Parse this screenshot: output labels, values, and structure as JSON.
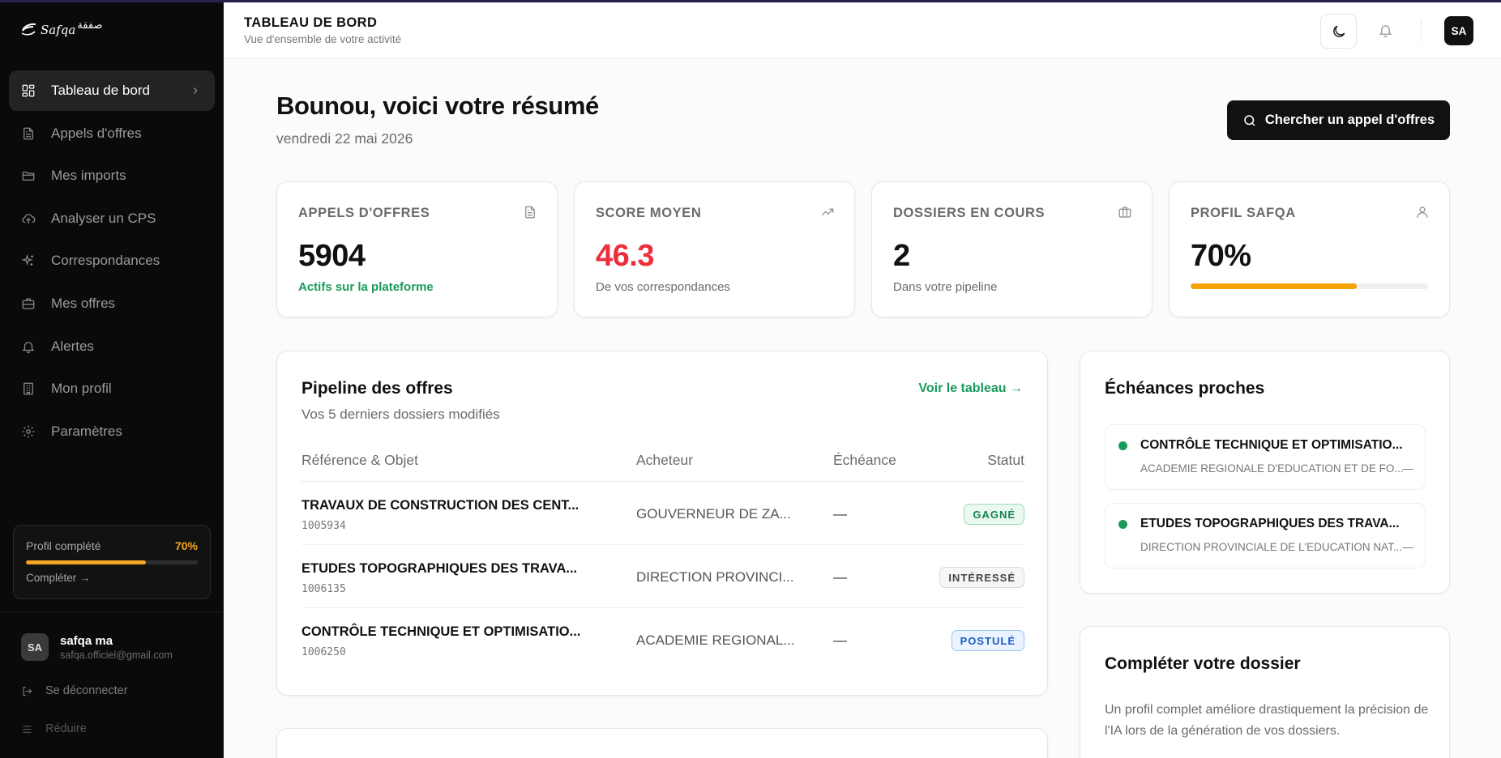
{
  "sidebar": {
    "logo": {
      "latin": "Safqa",
      "arabic": "صفقة"
    },
    "nav": [
      {
        "label": "Tableau de bord",
        "icon": "grid-icon"
      },
      {
        "label": "Appels d'offres",
        "icon": "document-icon"
      },
      {
        "label": "Mes imports",
        "icon": "folder-icon"
      },
      {
        "label": "Analyser un CPS",
        "icon": "upload-cloud-icon"
      },
      {
        "label": "Correspondances",
        "icon": "sparkles-icon"
      },
      {
        "label": "Mes offres",
        "icon": "briefcase-icon"
      },
      {
        "label": "Alertes",
        "icon": "bell-icon"
      },
      {
        "label": "Mon profil",
        "icon": "building-icon"
      },
      {
        "label": "Paramètres",
        "icon": "gear-icon"
      }
    ],
    "profile_progress": {
      "label": "Profil complété",
      "percent_label": "70%",
      "value": 0.7,
      "link": "Compléter →"
    },
    "user": {
      "initials": "SA",
      "name": "safqa ma",
      "email": "safqa.officiel@gmail.com"
    },
    "logout_label": "Se déconnecter",
    "collapse_label": "Réduire"
  },
  "header": {
    "title": "TABLEAU DE BORD",
    "subtitle": "Vue d'ensemble de votre activité",
    "avatar_initials": "SA"
  },
  "main": {
    "greeting": "Bounou, voici votre résumé",
    "date": "vendredi 22 mai 2026",
    "search_button": "Chercher un appel d'offres",
    "stats": [
      {
        "label": "APPELS D'OFFRES",
        "value": "5904",
        "sub": "Actifs sur la plateforme",
        "icon": "document-icon"
      },
      {
        "label": "SCORE MOYEN",
        "value": "46.3",
        "sub": "De vos correspondances",
        "icon": "trending-up-icon"
      },
      {
        "label": "DOSSIERS EN COURS",
        "value": "2",
        "sub": "Dans votre pipeline",
        "icon": "briefcase-icon"
      },
      {
        "label": "PROFIL SAFQA",
        "value": "70%",
        "progress": 0.7,
        "icon": "user-icon"
      }
    ],
    "pipeline": {
      "title": "Pipeline des offres",
      "subtitle": "Vos 5 derniers dossiers modifiés",
      "link": "Voir le tableau →",
      "columns": [
        "Référence & Objet",
        "Acheteur",
        "Échéance",
        "Statut"
      ],
      "rows": [
        {
          "title": "TRAVAUX DE CONSTRUCTION DES CENT...",
          "ref": "1005934",
          "buyer": "GOUVERNEUR DE ZA...",
          "deadline": "—",
          "status": "GAGNÉ"
        },
        {
          "title": "ETUDES TOPOGRAPHIQUES DES TRAVA...",
          "ref": "1006135",
          "buyer": "DIRECTION PROVINCI...",
          "deadline": "—",
          "status": "INTÉRESSÉ"
        },
        {
          "title": "CONTRÔLE TECHNIQUE ET OPTIMISATIO...",
          "ref": "1006250",
          "buyer": "ACADEMIE REGIONAL...",
          "deadline": "—",
          "status": "POSTULÉ"
        }
      ]
    },
    "echeances": {
      "title": "Échéances proches",
      "items": [
        {
          "title": "CONTRÔLE TECHNIQUE ET OPTIMISATIO...",
          "sub": "ACADEMIE REGIONALE D'EDUCATION ET DE FO...",
          "date": "—"
        },
        {
          "title": "ETUDES TOPOGRAPHIQUES DES TRAVA...",
          "sub": "DIRECTION PROVINCIALE DE L'EDUCATION NAT...",
          "date": "—"
        }
      ]
    },
    "complete_dossier": {
      "title": "Compléter votre dossier",
      "text": "Un profil complet améliore drastiquement la précision de l'IA lors de la génération de vos dossiers."
    }
  },
  "colors": {
    "accent_green": "#1a9b5c",
    "score_red": "#ee2e3c",
    "progress_orange": "#f5a300"
  }
}
